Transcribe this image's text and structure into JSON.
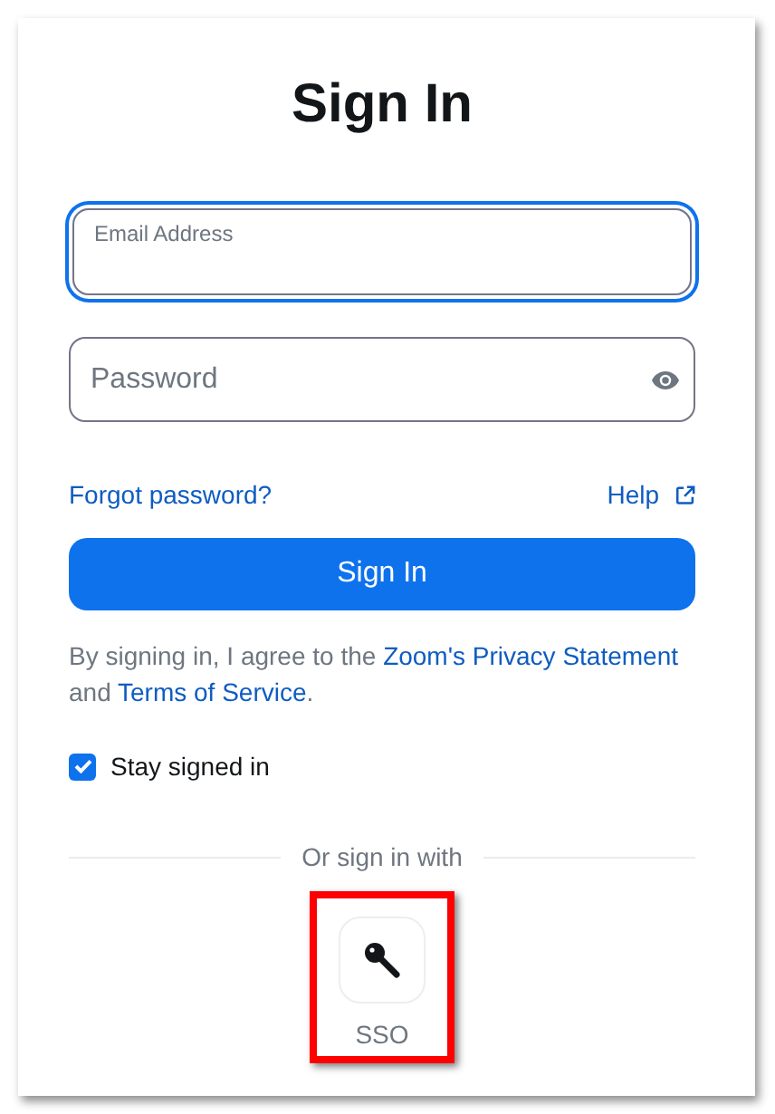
{
  "title": "Sign In",
  "email_field": {
    "label": "Email Address",
    "focused": true
  },
  "password_field": {
    "placeholder": "Password"
  },
  "links": [
    {
      "label": "Forgot password?",
      "external": false
    },
    {
      "label": "Help",
      "external": true
    }
  ],
  "sign_in_button": "Sign In",
  "terms": {
    "parts": [
      {
        "text": "By signing in, I agree to the ",
        "link": false
      },
      {
        "text": "Zoom's Privacy Statement",
        "link": true
      },
      {
        "text": " and ",
        "link": false
      },
      {
        "text": "Terms of Service",
        "link": true
      },
      {
        "text": ".",
        "link": false
      }
    ]
  },
  "stay_signed_in": {
    "label": "Stay signed in",
    "checked": true
  },
  "divider_label": "Or sign in with",
  "sso_options": [
    {
      "label": "SSO",
      "highlighted": true
    }
  ]
}
